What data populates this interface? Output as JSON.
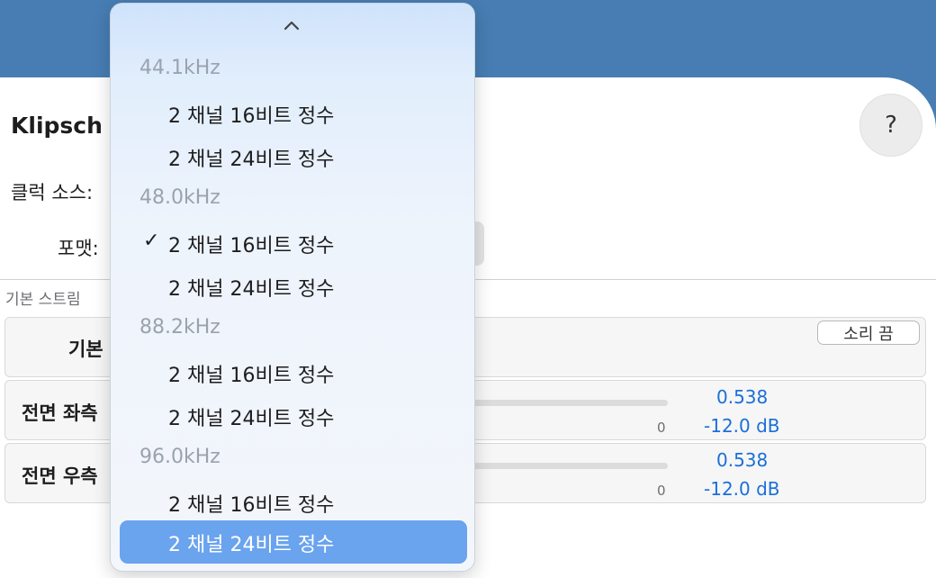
{
  "window": {
    "device_title": "Klipsch",
    "help_label": "?",
    "clock_source_label": "클럭 소스:",
    "format_label": "포맷:",
    "section_label": "기본 스트림"
  },
  "rows": [
    {
      "label": "기본",
      "mute_label": "소리 끔"
    },
    {
      "label": "전면 좌측",
      "zero": "0",
      "value": "0.538",
      "db": "-12.0 dB",
      "level": 0
    },
    {
      "label": "전면 우측",
      "zero": "0",
      "value": "0.538",
      "db": "-12.0 dB",
      "level": 0
    }
  ],
  "menu": {
    "scroll_up_icon": "chevron-up-icon",
    "groups": [
      {
        "header": "44.1kHz",
        "items": [
          "2 채널 16비트 정수",
          "2 채널 24비트 정수"
        ]
      },
      {
        "header": "48.0kHz",
        "items": [
          "2 채널 16비트 정수",
          "2 채널 24비트 정수"
        ]
      },
      {
        "header": "88.2kHz",
        "items": [
          "2 채널 16비트 정수",
          "2 채널 24비트 정수"
        ]
      },
      {
        "header": "96.0kHz",
        "items": [
          "2 채널 16비트 정수",
          "2 채널 24비트 정수"
        ]
      }
    ],
    "checked": "48.0kHz / 2 채널 16비트 정수",
    "checkmark": "✓",
    "highlighted": "96.0kHz / 2 채널 24비트 정수"
  },
  "colors": {
    "desktop": "#477db3",
    "accent_value": "#1b6fd8",
    "highlight": "#6aa3ee"
  }
}
